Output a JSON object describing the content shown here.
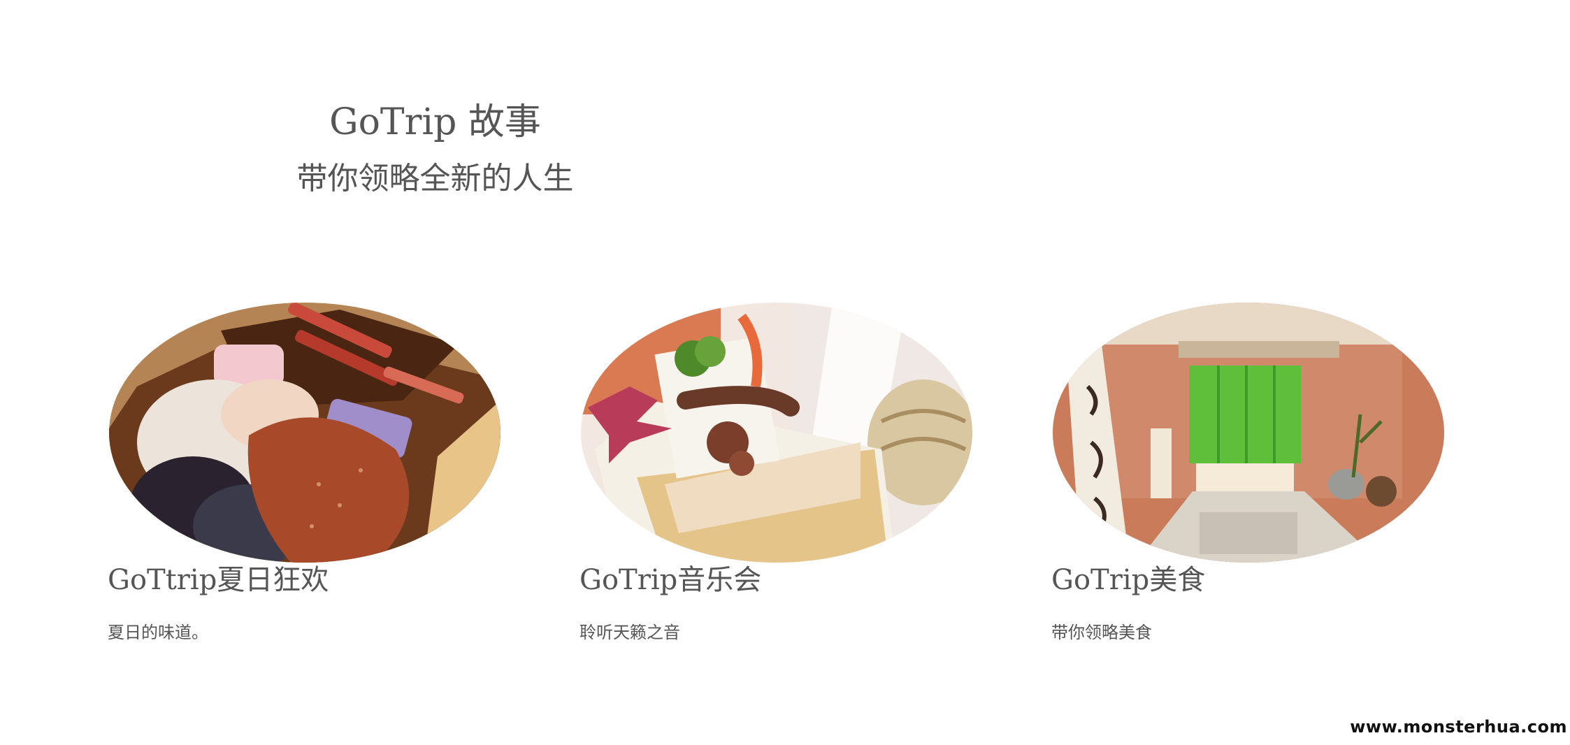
{
  "hero": {
    "title": "GoTrip 故事",
    "subtitle": "带你领略全新的人生"
  },
  "cards": [
    {
      "title": "GoTtrip夏日狂欢",
      "description": "夏日的味道。",
      "image_subject": "souvenir pouches and chopsticks in wooden box"
    },
    {
      "title": "GoTrip音乐会",
      "description": "聆听天籁之音",
      "image_subject": "japanese food in wooden masu box with maple leaf"
    },
    {
      "title": "GoTrip美食",
      "description": "带你领略美食",
      "image_subject": "onsen entrance with green noren curtain"
    }
  ],
  "watermark": "www.monsterhua.com",
  "colors": {
    "text": "#555555",
    "background": "#ffffff",
    "noren_green": "#5fbf3a"
  }
}
